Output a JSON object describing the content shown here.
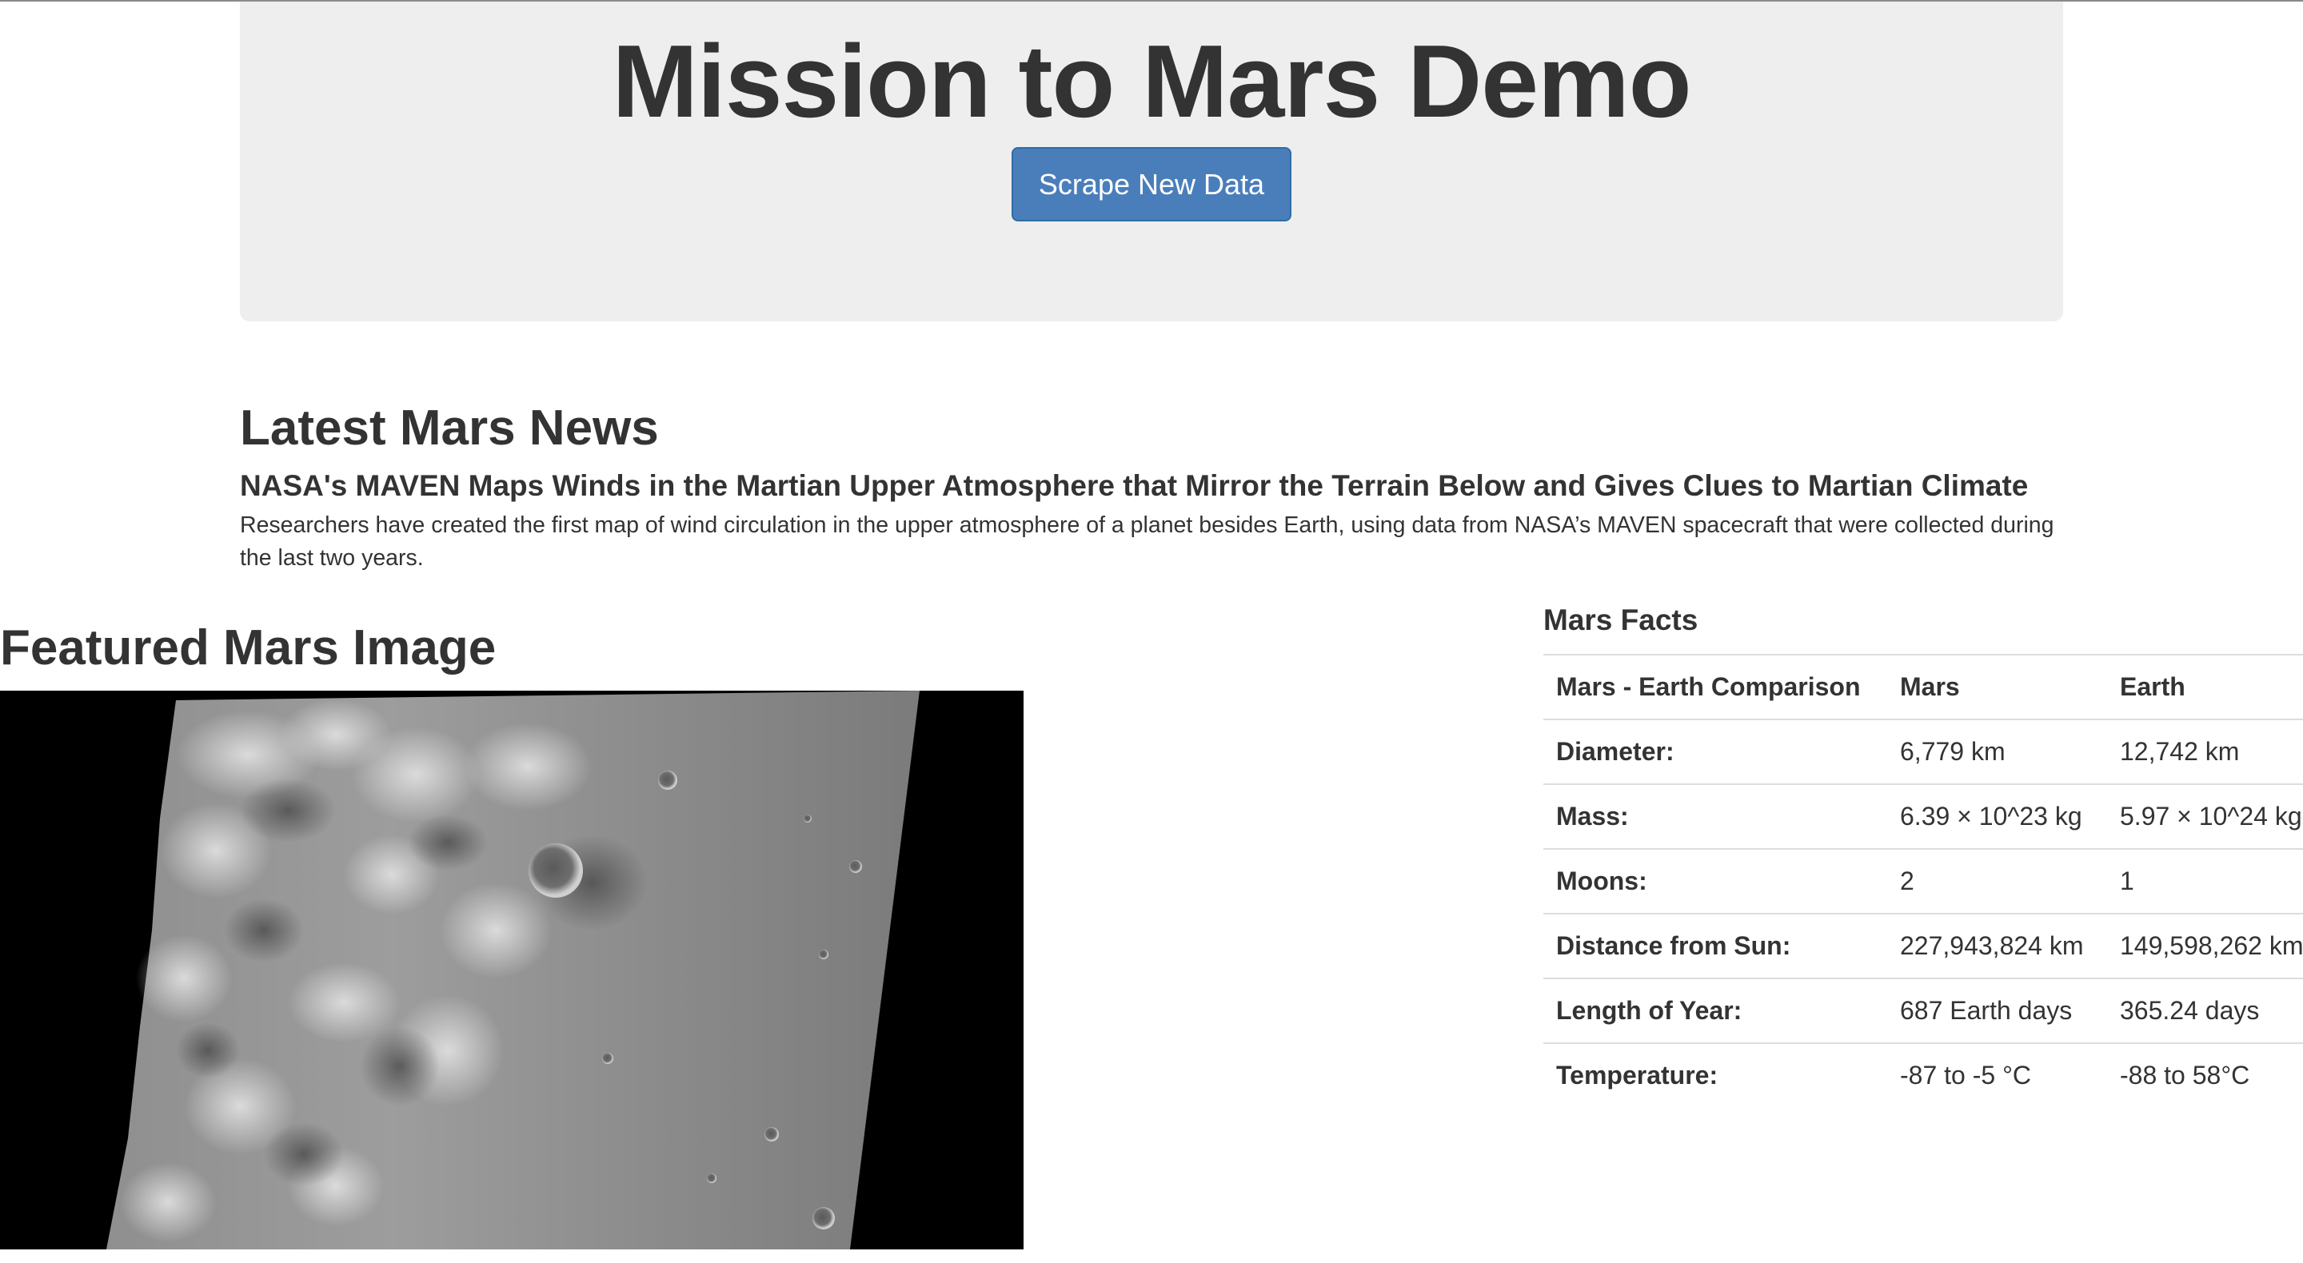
{
  "header": {
    "title": "Mission to Mars Demo",
    "scrape_button_label": "Scrape New Data"
  },
  "news": {
    "heading": "Latest Mars News",
    "title": "NASA's MAVEN Maps Winds in the Martian Upper Atmosphere that Mirror the Terrain Below and Gives Clues to Martian Climate",
    "teaser": "Researchers have created the first map of wind circulation in the upper atmosphere of a planet besides Earth, using data from NASA’s MAVEN spacecraft that were collected during the last two years."
  },
  "featured_image": {
    "heading": "Featured Mars Image"
  },
  "facts": {
    "heading": "Mars Facts",
    "columns": [
      "Mars - Earth Comparison",
      "Mars",
      "Earth"
    ],
    "rows": [
      {
        "label": "Diameter:",
        "mars": "6,779 km",
        "earth": "12,742 km"
      },
      {
        "label": "Mass:",
        "mars": "6.39 × 10^23 kg",
        "earth": "5.97 × 10^24 kg"
      },
      {
        "label": "Moons:",
        "mars": "2",
        "earth": "1"
      },
      {
        "label": "Distance from Sun:",
        "mars": "227,943,824 km",
        "earth": "149,598,262 km"
      },
      {
        "label": "Length of Year:",
        "mars": "687 Earth days",
        "earth": "365.24 days"
      },
      {
        "label": "Temperature:",
        "mars": "-87 to -5 °C",
        "earth": "-88 to 58°C"
      }
    ]
  },
  "colors": {
    "jumbotron_bg": "#eeeeee",
    "button_primary": "#4a7ebb",
    "text": "#333333"
  }
}
